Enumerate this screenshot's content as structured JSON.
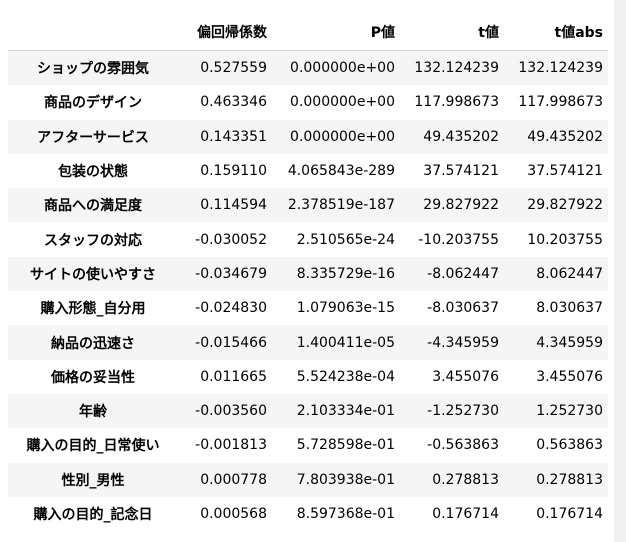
{
  "table": {
    "columns": [
      "",
      "偏回帰係数",
      "P値",
      "t値",
      "t値abs"
    ],
    "rows": [
      {
        "label": "ショップの雰囲気",
        "coef": "0.527559",
        "p": "0.000000e+00",
        "t": "132.124239",
        "tabs": "132.124239"
      },
      {
        "label": "商品のデザイン",
        "coef": "0.463346",
        "p": "0.000000e+00",
        "t": "117.998673",
        "tabs": "117.998673"
      },
      {
        "label": "アフターサービス",
        "coef": "0.143351",
        "p": "0.000000e+00",
        "t": "49.435202",
        "tabs": "49.435202"
      },
      {
        "label": "包装の状態",
        "coef": "0.159110",
        "p": "4.065843e-289",
        "t": "37.574121",
        "tabs": "37.574121"
      },
      {
        "label": "商品への満足度",
        "coef": "0.114594",
        "p": "2.378519e-187",
        "t": "29.827922",
        "tabs": "29.827922"
      },
      {
        "label": "スタッフの対応",
        "coef": "-0.030052",
        "p": "2.510565e-24",
        "t": "-10.203755",
        "tabs": "10.203755"
      },
      {
        "label": "サイトの使いやすさ",
        "coef": "-0.034679",
        "p": "8.335729e-16",
        "t": "-8.062447",
        "tabs": "8.062447"
      },
      {
        "label": "購入形態_自分用",
        "coef": "-0.024830",
        "p": "1.079063e-15",
        "t": "-8.030637",
        "tabs": "8.030637"
      },
      {
        "label": "納品の迅速さ",
        "coef": "-0.015466",
        "p": "1.400411e-05",
        "t": "-4.345959",
        "tabs": "4.345959"
      },
      {
        "label": "価格の妥当性",
        "coef": "0.011665",
        "p": "5.524238e-04",
        "t": "3.455076",
        "tabs": "3.455076"
      },
      {
        "label": "年齢",
        "coef": "-0.003560",
        "p": "2.103334e-01",
        "t": "-1.252730",
        "tabs": "1.252730"
      },
      {
        "label": "購入の目的_日常使い",
        "coef": "-0.001813",
        "p": "5.728598e-01",
        "t": "-0.563863",
        "tabs": "0.563863"
      },
      {
        "label": "性別_男性",
        "coef": "0.000778",
        "p": "7.803938e-01",
        "t": "0.278813",
        "tabs": "0.278813"
      },
      {
        "label": "購入の目的_記念日",
        "coef": "0.000568",
        "p": "8.597368e-01",
        "t": "0.176714",
        "tabs": "0.176714"
      }
    ]
  }
}
